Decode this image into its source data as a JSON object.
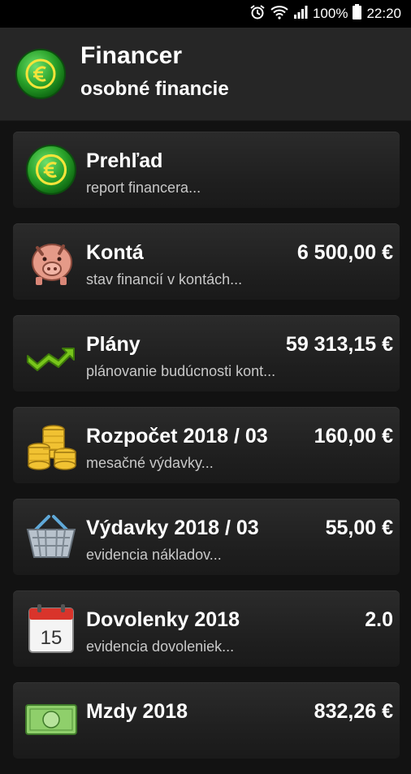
{
  "status": {
    "battery": "100%",
    "time": "22:20"
  },
  "header": {
    "title": "Financer",
    "subtitle": "osobné financie"
  },
  "items": [
    {
      "title": "Prehľad",
      "subtitle": "report financera...",
      "value": ""
    },
    {
      "title": "Kontá",
      "subtitle": "stav financií v kontách...",
      "value": "6 500,00 €"
    },
    {
      "title": "Plány",
      "subtitle": "plánovanie budúcnosti kont...",
      "value": "59 313,15 €"
    },
    {
      "title": "Rozpočet 2018 / 03",
      "subtitle": "mesačné výdavky...",
      "value": "160,00 €"
    },
    {
      "title": "Výdavky 2018 / 03",
      "subtitle": "evidencia nákladov...",
      "value": "55,00 €"
    },
    {
      "title": "Dovolenky 2018",
      "subtitle": "evidencia dovoleniek...",
      "value": "2.0"
    },
    {
      "title": "Mzdy 2018",
      "subtitle": "",
      "value": "832,26 €"
    }
  ],
  "calendar_day": "15"
}
